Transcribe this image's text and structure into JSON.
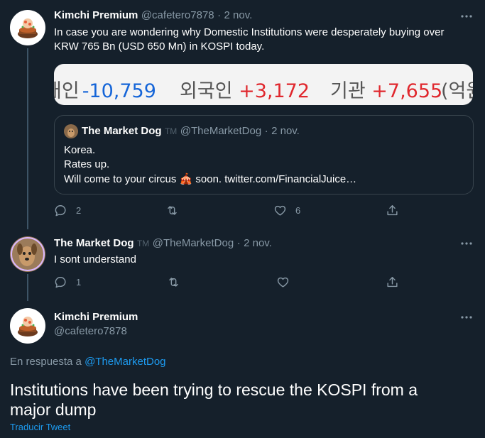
{
  "tweet1": {
    "name": "Kimchi Premium",
    "handle": "@cafetero7878",
    "sep": "·",
    "date": "2 nov.",
    "text_line1": "In case you are wondering why Domestic Institutions were desperately buying over",
    "text_line2": "KRW 765 Bn (USD 650 Mn) in KOSPI today.",
    "media": {
      "items": [
        {
          "label": "개인",
          "value": "-10,759"
        },
        {
          "label": "외국인",
          "value": "+3,172"
        },
        {
          "label": "기관",
          "value": "+7,655"
        },
        {
          "label": "(억원",
          "value": ""
        }
      ]
    },
    "quote": {
      "name": "The Market Dog",
      "tm": "TM",
      "handle": "@TheMarketDog",
      "sep": "·",
      "date": "2 nov.",
      "line1": "Korea.",
      "line2": "Rates up.",
      "line3_pre": "Will come to your circus",
      "line3_emoji": "🎪",
      "line3_post": "soon. twitter.com/FinancialJuice…"
    },
    "replies": "2",
    "likes": "6"
  },
  "tweet2": {
    "name": "The Market Dog",
    "tm": "TM",
    "handle": "@TheMarketDog",
    "sep": "·",
    "date": "2 nov.",
    "text": "I sont understand",
    "replies": "1"
  },
  "tweet3": {
    "name": "Kimchi Premium",
    "handle": "@cafetero7878",
    "reply_to_label": "En respuesta a",
    "reply_to_handle": "@TheMarketDog",
    "text_line1": "Institutions have been trying to rescue the KOSPI from a",
    "text_line2": "major dump",
    "translate": "Traducir Tweet"
  },
  "colors": {
    "background": "#15202b",
    "muted": "#8899a6",
    "link": "#1d9bf0",
    "positive": "#e0282e",
    "negative": "#1565d8"
  }
}
